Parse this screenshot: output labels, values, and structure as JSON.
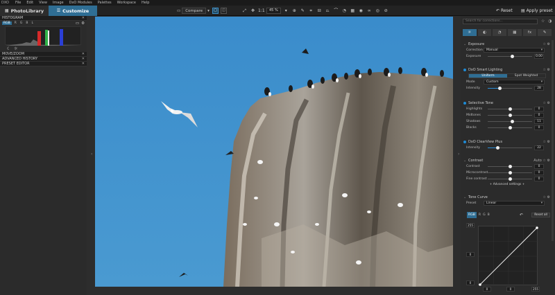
{
  "menu": [
    "File",
    "Edit",
    "View",
    "Image",
    "DxO Modules",
    "Palettes",
    "Workspace",
    "Help"
  ],
  "logo": "DXO",
  "tabs": {
    "library": "PhotoLibrary",
    "customize": "Customize"
  },
  "toolbar": {
    "compare": "Compare",
    "zoom": "45 %",
    "one_to_one": "1:1",
    "reset": "Reset",
    "apply_preset": "Apply preset"
  },
  "left_panel": {
    "histogram": {
      "title": "HISTOGRAM",
      "channels": [
        "RGB",
        "R",
        "G",
        "B",
        "L"
      ],
      "active_channel": "RGB"
    },
    "sections": [
      "MOVE/ZOOM",
      "ADVANCED HISTORY",
      "PRESET EDITOR"
    ]
  },
  "right_panel": {
    "search_placeholder": "Search for corrections...",
    "palette_tabs": [
      "☼",
      "◐",
      "◔",
      "▦",
      "fx",
      "✎"
    ],
    "exposure": {
      "title": "Exposure",
      "correction_label": "Correction",
      "correction_value": "Manual",
      "exposure_label": "Exposure",
      "exposure_value": "0.00",
      "exposure_pos": 0.55
    },
    "smart_lighting": {
      "title": "DxO Smart Lighting",
      "modes": [
        "Uniform",
        "Spot Weighted"
      ],
      "active_mode": "Uniform",
      "mode_label": "Mode",
      "mode_value": "Custom",
      "intensity_label": "Intensity",
      "intensity_value": "28",
      "intensity_pos": 0.28
    },
    "selective_tone": {
      "title": "Selective Tone",
      "rows": [
        {
          "label": "Highlights",
          "value": "0",
          "pos": 0.5
        },
        {
          "label": "Midtones",
          "value": "0",
          "pos": 0.5
        },
        {
          "label": "Shadows",
          "value": "11",
          "pos": 0.555
        },
        {
          "label": "Blacks",
          "value": "0",
          "pos": 0.5
        }
      ]
    },
    "clearview": {
      "title": "DxO ClearView Plus",
      "intensity_label": "Intensity",
      "intensity_value": "22",
      "intensity_pos": 0.22
    },
    "contrast": {
      "title": "Contrast",
      "auto_label": "Auto",
      "rows": [
        {
          "label": "Contrast",
          "value": "0",
          "pos": 0.5
        },
        {
          "label": "Microcontrast",
          "value": "0",
          "pos": 0.5
        },
        {
          "label": "Fine contrast",
          "value": "0",
          "pos": 0.5
        }
      ],
      "advanced": "+ Advanced settings +"
    },
    "tone_curve": {
      "title": "Tone Curve",
      "preset_label": "Preset",
      "preset_value": "Linear",
      "channels": [
        "RGB",
        "R",
        "G",
        "B"
      ],
      "active_channel": "RGB",
      "reset_all": "Reset all",
      "max_in": "255",
      "mid_left": "0",
      "min_in": "0",
      "out_min": "0",
      "out_mid": "0",
      "out_max": "255"
    }
  },
  "colors": {
    "accent": "#2f6e94",
    "slider": "#2b8fd8",
    "sky": "#3d8fc8"
  }
}
